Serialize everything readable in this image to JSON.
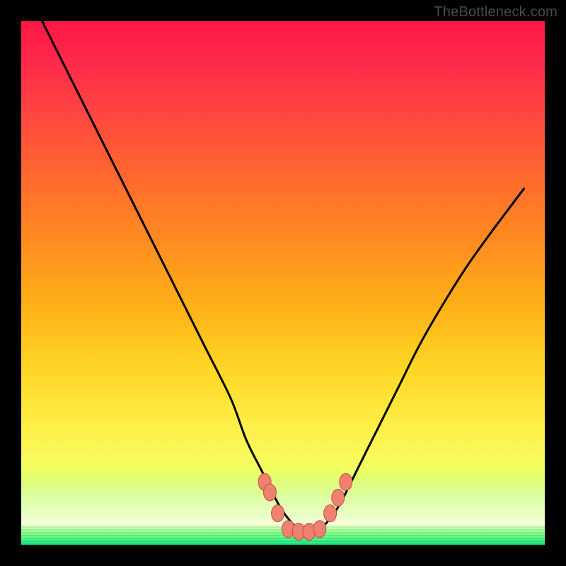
{
  "watermark": "TheBottleneck.com",
  "colors": {
    "frame": "#000000",
    "gradient_top": "#ff1744",
    "gradient_mid": "#ffd826",
    "gradient_bottom": "#00e676",
    "curve_stroke": "#000000",
    "marker_fill": "#f08070",
    "marker_stroke": "#c05040"
  },
  "chart_data": {
    "type": "line",
    "title": "",
    "xlabel": "",
    "ylabel": "",
    "xlim": [
      0,
      100
    ],
    "ylim": [
      0,
      100
    ],
    "grid": false,
    "legend": false,
    "series": [
      {
        "name": "bottleneck-curve",
        "x": [
          4,
          10,
          15,
          20,
          25,
          30,
          35,
          40,
          43,
          46,
          49,
          51,
          53,
          55,
          57,
          59,
          61,
          64,
          68,
          72,
          76,
          80,
          85,
          90,
          96
        ],
        "y": [
          100,
          88,
          78,
          68,
          58,
          48,
          38,
          28,
          20,
          14,
          8,
          5,
          3,
          2.5,
          3,
          5,
          8,
          14,
          22,
          30,
          38,
          45,
          53,
          60,
          68
        ]
      }
    ],
    "markers": {
      "name": "highlight-cluster",
      "x": [
        46.5,
        47.5,
        49,
        51,
        53,
        55,
        57,
        59,
        60.5,
        62
      ],
      "y": [
        12,
        10,
        6,
        3,
        2.5,
        2.5,
        3,
        6,
        9,
        12
      ]
    },
    "bands": [
      {
        "name": "green-zone",
        "y_from": 0,
        "y_to": 4,
        "color": "#00e676"
      },
      {
        "name": "pale-zone",
        "y_from": 4,
        "y_to": 14,
        "color": "#f5ffbf"
      }
    ]
  }
}
